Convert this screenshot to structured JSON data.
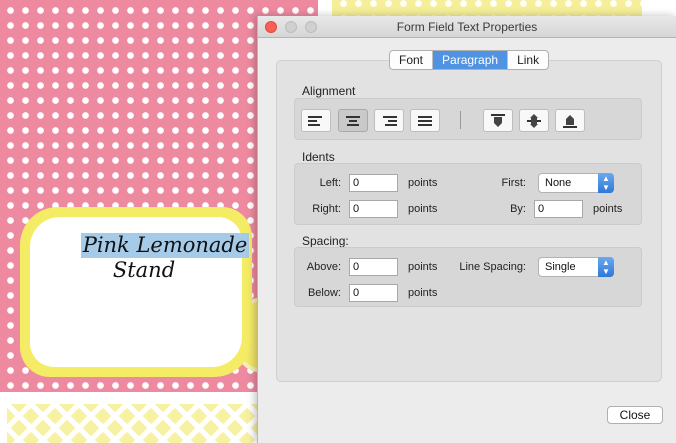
{
  "document": {
    "label_line1": "Pink Lemonade",
    "label_line2": "Stand"
  },
  "dialog": {
    "title": "Form Field Text Properties",
    "tabs": [
      {
        "label": "Font",
        "active": false
      },
      {
        "label": "Paragraph",
        "active": true
      },
      {
        "label": "Link",
        "active": false
      }
    ],
    "alignment": {
      "label": "Alignment",
      "horizontal_selected": "center",
      "horizontal": [
        "align-left-icon",
        "align-center-icon",
        "align-right-icon",
        "align-justify-icon"
      ],
      "vertical": [
        "valign-top-icon",
        "valign-middle-icon",
        "valign-bottom-icon"
      ]
    },
    "idents": {
      "label": "Idents",
      "left_label": "Left:",
      "left_value": "0",
      "left_unit": "points",
      "right_label": "Right:",
      "right_value": "0",
      "right_unit": "points",
      "first_label": "First:",
      "first_value": "None",
      "by_label": "By:",
      "by_value": "0",
      "by_unit": "points"
    },
    "spacing": {
      "label": "Spacing:",
      "above_label": "Above:",
      "above_value": "0",
      "above_unit": "points",
      "below_label": "Below:",
      "below_value": "0",
      "below_unit": "points",
      "line_spacing_label": "Line Spacing:",
      "line_spacing_value": "Single"
    },
    "close_label": "Close"
  },
  "colors": {
    "accent": "#4f93e2",
    "pink": "#ee8aa0",
    "yellow": "#f5ec66",
    "highlight": "#a6cbe8"
  }
}
